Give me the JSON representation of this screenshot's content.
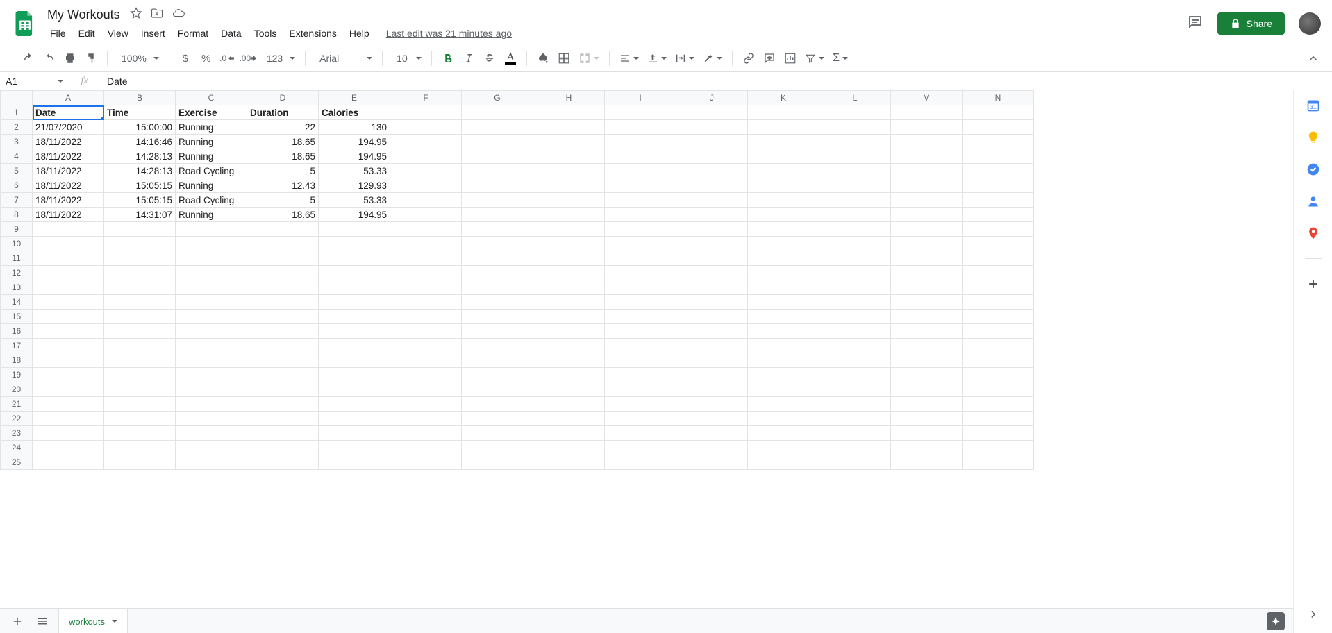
{
  "doc": {
    "title": "My Workouts",
    "last_edit": "Last edit was 21 minutes ago"
  },
  "menus": {
    "items": [
      "File",
      "Edit",
      "View",
      "Insert",
      "Format",
      "Data",
      "Tools",
      "Extensions",
      "Help"
    ]
  },
  "share": {
    "label": "Share"
  },
  "toolbar": {
    "zoom": "100%",
    "font": "Arial",
    "font_size": "10",
    "number_format": "123"
  },
  "name_box": {
    "value": "A1"
  },
  "formula": {
    "value": "Date"
  },
  "columns": [
    "A",
    "B",
    "C",
    "D",
    "E",
    "F",
    "G",
    "H",
    "I",
    "J",
    "K",
    "L",
    "M",
    "N"
  ],
  "row_count": 25,
  "headers": [
    "Date",
    "Time",
    "Exercise",
    "Duration",
    "Calories"
  ],
  "rows": [
    {
      "date": "21/07/2020",
      "time": "15:00:00",
      "exercise": "Running",
      "duration": "22",
      "calories": "130"
    },
    {
      "date": "18/11/2022",
      "time": "14:16:46",
      "exercise": "Running",
      "duration": "18.65",
      "calories": "194.95"
    },
    {
      "date": "18/11/2022",
      "time": "14:28:13",
      "exercise": "Running",
      "duration": "18.65",
      "calories": "194.95"
    },
    {
      "date": "18/11/2022",
      "time": "14:28:13",
      "exercise": "Road Cycling",
      "duration": "5",
      "calories": "53.33"
    },
    {
      "date": "18/11/2022",
      "time": "15:05:15",
      "exercise": "Running",
      "duration": "12.43",
      "calories": "129.93"
    },
    {
      "date": "18/11/2022",
      "time": "15:05:15",
      "exercise": "Road Cycling",
      "duration": "5",
      "calories": "53.33"
    },
    {
      "date": "18/11/2022",
      "time": "14:31:07",
      "exercise": "Running",
      "duration": "18.65",
      "calories": "194.95"
    }
  ],
  "sheet_tabs": {
    "active": "workouts"
  }
}
